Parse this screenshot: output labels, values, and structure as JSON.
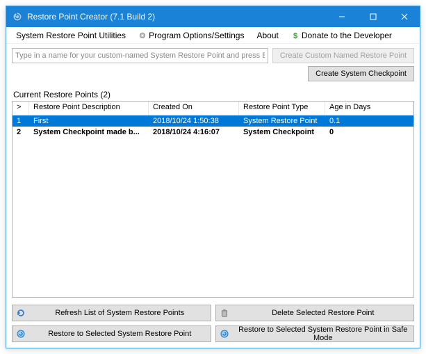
{
  "window": {
    "title": "Restore Point Creator (7.1 Build 2)"
  },
  "menu": {
    "utilities": "System Restore Point Utilities",
    "options": "Program Options/Settings",
    "about": "About",
    "donate": "Donate to the Developer"
  },
  "toolbar": {
    "name_placeholder": "Type in a name for your custom-named System Restore Point and press Enter...",
    "create_custom": "Create Custom Named Restore Point",
    "create_checkpoint": "Create System Checkpoint"
  },
  "list": {
    "group_label": "Current Restore Points (2)",
    "headers": {
      "idx": ">",
      "desc": "Restore Point Description",
      "created": "Created On",
      "type": "Restore Point Type",
      "age": "Age in Days"
    },
    "rows": [
      {
        "idx": "1",
        "desc": "First",
        "created": "2018/10/24 1:50:38",
        "type": "System Restore Point",
        "age": "0.1",
        "selected": true,
        "bold": false
      },
      {
        "idx": "2",
        "desc": "System Checkpoint made b...",
        "created": "2018/10/24 4:16:07",
        "type": "System Checkpoint",
        "age": "0",
        "selected": false,
        "bold": true
      }
    ]
  },
  "footer": {
    "refresh": "Refresh List of System Restore Points",
    "delete": "Delete Selected Restore Point",
    "restore": "Restore to Selected System Restore Point",
    "restore_safe": "Restore to Selected System Restore Point in Safe Mode"
  },
  "icons": {
    "app": "restore-point-creator-icon",
    "gear": "gear-icon",
    "dollar": "dollar-icon",
    "refresh": "refresh-icon",
    "delete": "trash-icon",
    "restore": "restore-icon"
  }
}
